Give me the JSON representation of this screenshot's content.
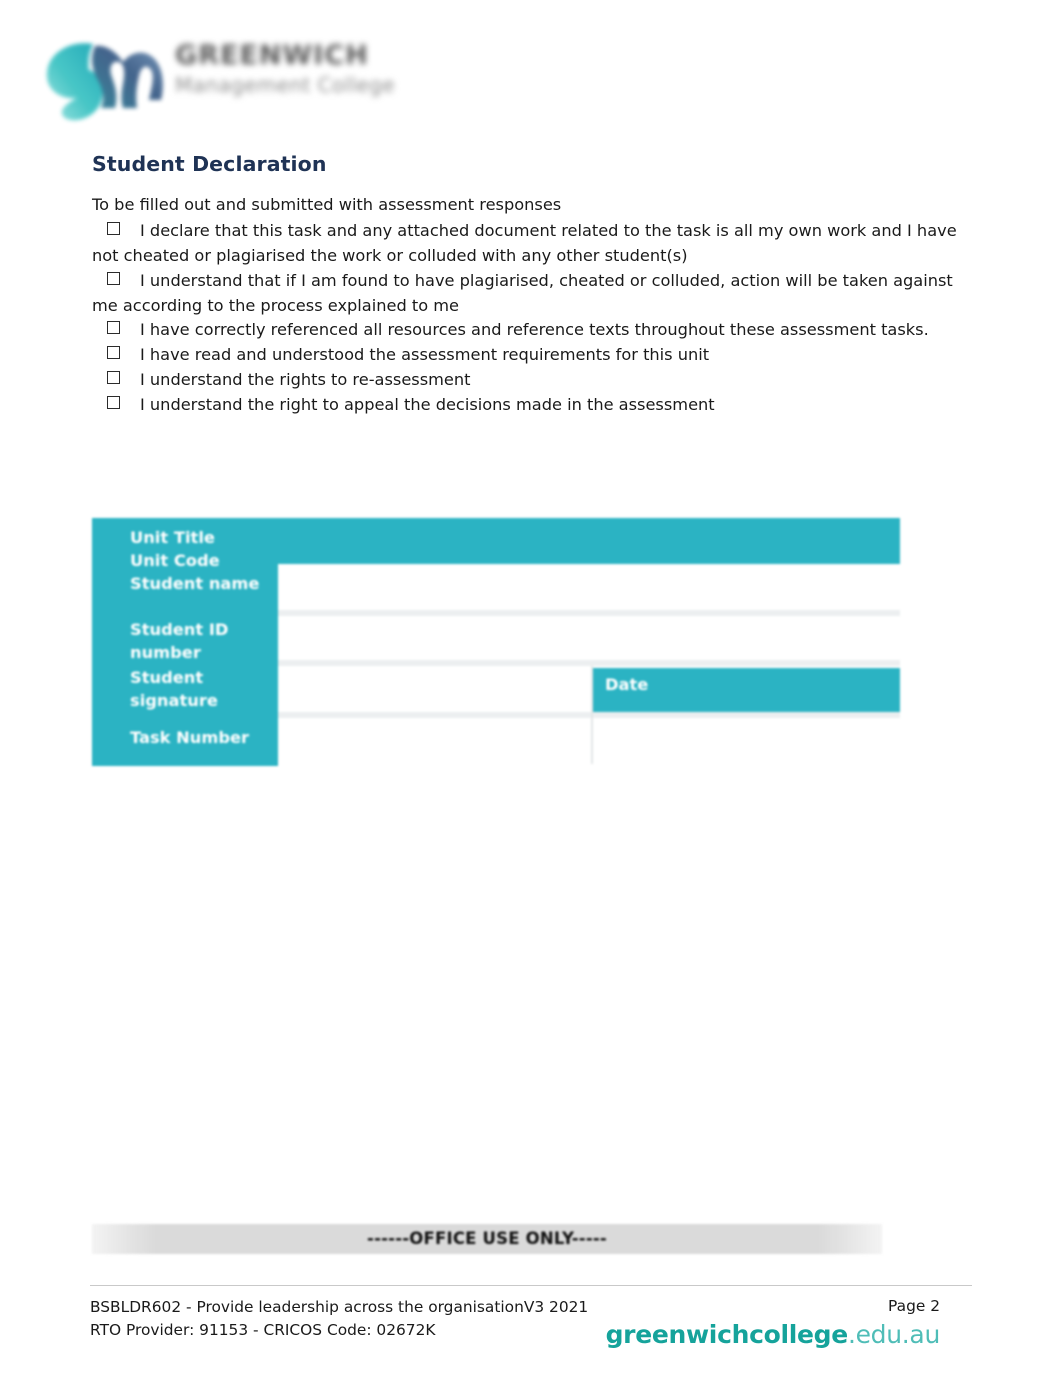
{
  "header": {
    "logo_icon": "greenwich-gm-logo-icon",
    "wordmark_line1": "GREENWICH",
    "wordmark_line2": "Management College"
  },
  "main": {
    "title": "Student Declaration",
    "intro": "To be filled out and submitted with assessment responses",
    "declarations": [
      "I declare that this task and any attached document related to the task is all my own work and I have not cheated or plagiarised the work or colluded with any other student(s)",
      "I understand that if I am found to have plagiarised, cheated or colluded, action will be taken against me according to the process explained to me",
      "I have correctly referenced all resources and reference texts throughout these assessment tasks.",
      "I have read and understood the assessment requirements for this unit",
      "I understand the rights to re-assessment",
      "I understand the right to appeal the decisions made in the assessment"
    ]
  },
  "form_table": {
    "labels": {
      "unit_title": "Unit Title",
      "unit_code": "Unit Code",
      "student_name": "Student name",
      "student_id": "Student ID number",
      "student_signature": "Student signature",
      "task_number": "Task Number",
      "date": "Date"
    },
    "values": {
      "unit_title": "",
      "unit_code": "",
      "student_name": "",
      "student_id": "",
      "student_signature": "",
      "date": "",
      "task_number": "",
      "task_number_right": ""
    }
  },
  "office_use": {
    "banner": "------OFFICE USE ONLY-----"
  },
  "footer": {
    "unit_line": "BSBLDR602 - Provide leadership across the organisationV3 2021",
    "rto_line": "RTO Provider: 91153  - CRICOS  Code: 02672K",
    "page_label": "Page 2",
    "url_strong": "greenwichcollege",
    "url_light": ".edu.au"
  },
  "colors": {
    "teal": "#2BB3C3",
    "heading_navy": "#1F3355",
    "url_teal": "#15A39B",
    "office_band_gray": "#D8D8D8"
  }
}
